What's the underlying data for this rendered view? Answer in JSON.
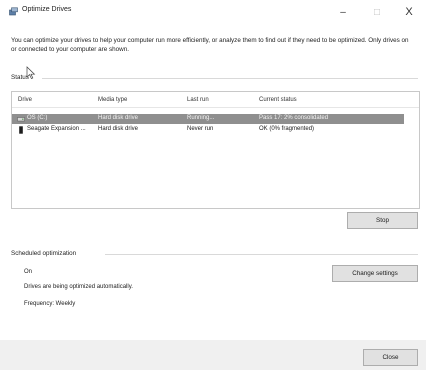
{
  "window": {
    "title": "Optimize Drives",
    "minimize_glyph": "–",
    "maximize_glyph": "□",
    "close_glyph": "X",
    "icon": "defrag-drive-icon"
  },
  "description": "You can optimize your drives to help your computer run more efficiently, or analyze them to find out if they need to be optimized. Only drives on or connected to your computer are shown.",
  "status": {
    "label": "Status",
    "columns": [
      "Drive",
      "Media type",
      "Last run",
      "Current status"
    ],
    "rows": [
      {
        "drive": "OS (C:)",
        "media_type": "Hard disk drive",
        "last_run": "Running...",
        "current_status": "Pass 17: 2% consolidated",
        "selected": true,
        "icon": "hard-drive-icon"
      },
      {
        "drive": "Seagate Expansion ...",
        "media_type": "Hard disk drive",
        "last_run": "Never run",
        "current_status": "OK (0% fragmented)",
        "selected": false,
        "icon": "external-drive-icon"
      }
    ],
    "stop_label": "Stop"
  },
  "scheduled": {
    "label": "Scheduled optimization",
    "state": "On",
    "info": "Drives are being optimized automatically.",
    "frequency": "Frequency: Weekly",
    "change_label": "Change settings"
  },
  "footer": {
    "close_label": "Close"
  },
  "colors": {
    "selected_row": "#8f8f8f",
    "button_bg": "#e1e1e1",
    "footer_bg": "#f0f0f0"
  }
}
